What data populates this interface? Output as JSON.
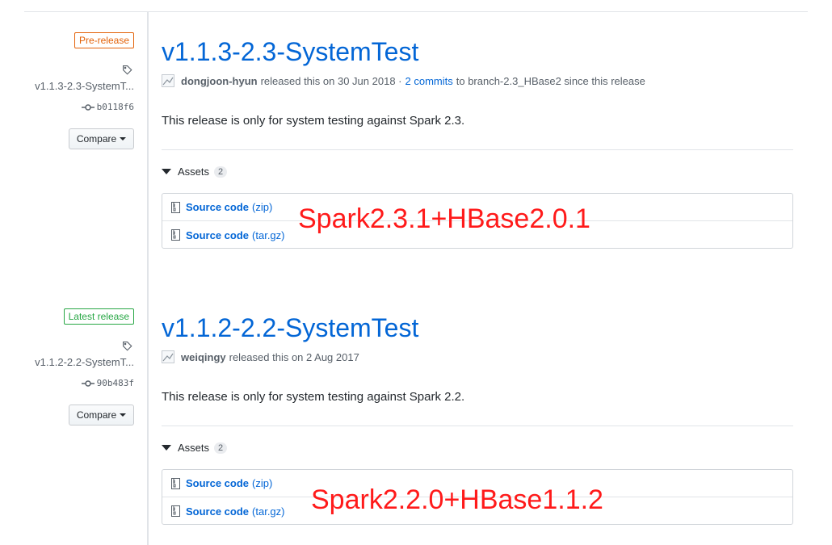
{
  "releases": [
    {
      "badge": "Pre-release",
      "tag": "v1.1.3-2.3-SystemT...",
      "commit": "b0118f6",
      "compare_label": "Compare",
      "title": "v1.1.3-2.3-SystemTest",
      "author": "dongjoon-hyun",
      "released_text": "released this on 30 Jun 2018 ·",
      "commits_link": "2 commits",
      "branch_text": "to branch-2.3_HBase2 since this release",
      "description": "This release is only for system testing against Spark 2.3.",
      "assets_label": "Assets",
      "assets_count": "2",
      "assets": [
        {
          "name": "Source code",
          "ext": "(zip)"
        },
        {
          "name": "Source code",
          "ext": "(tar.gz)"
        }
      ],
      "annotation": "Spark2.3.1+HBase2.0.1"
    },
    {
      "badge": "Latest release",
      "tag": "v1.1.2-2.2-SystemT...",
      "commit": "90b483f",
      "compare_label": "Compare",
      "title": "v1.1.2-2.2-SystemTest",
      "author": "weiqingy",
      "released_text": "released this on 2 Aug 2017",
      "description": "This release is only for system testing against Spark 2.2.",
      "assets_label": "Assets",
      "assets_count": "2",
      "assets": [
        {
          "name": "Source code",
          "ext": "(zip)"
        },
        {
          "name": "Source code",
          "ext": "(tar.gz)"
        }
      ],
      "annotation": "Spark2.2.0+HBase1.1.2"
    }
  ],
  "colors": {
    "link": "#0366d6",
    "pre_release": "#e36209",
    "latest_release": "#28a745",
    "annotation": "#ff1a1a"
  },
  "icons": [
    "tag-icon",
    "git-commit-icon",
    "caret-down-icon",
    "avatar",
    "file-zip-icon",
    "triangle-down-icon"
  ]
}
